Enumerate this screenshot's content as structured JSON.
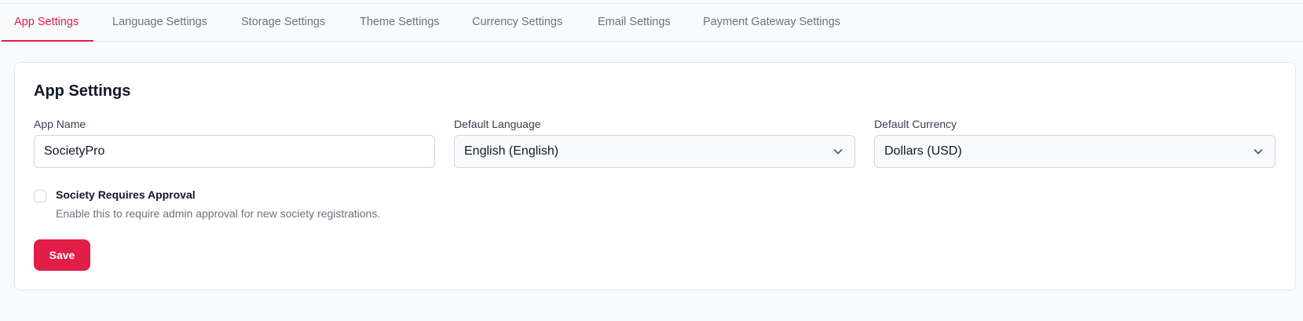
{
  "tabs": [
    {
      "label": "App Settings",
      "active": true
    },
    {
      "label": "Language Settings",
      "active": false
    },
    {
      "label": "Storage Settings",
      "active": false
    },
    {
      "label": "Theme Settings",
      "active": false
    },
    {
      "label": "Currency Settings",
      "active": false
    },
    {
      "label": "Email Settings",
      "active": false
    },
    {
      "label": "Payment Gateway Settings",
      "active": false
    }
  ],
  "card": {
    "title": "App Settings",
    "fields": {
      "app_name": {
        "label": "App Name",
        "value": "SocietyPro"
      },
      "default_language": {
        "label": "Default Language",
        "value": "English (English)"
      },
      "default_currency": {
        "label": "Default Currency",
        "value": "Dollars (USD)"
      }
    },
    "approval": {
      "label": "Society Requires Approval",
      "help": "Enable this to require admin approval for new society registrations.",
      "checked": false
    },
    "save_label": "Save"
  },
  "colors": {
    "accent": "#e11d48",
    "background": "#f9fafb",
    "border": "#e5e7eb"
  },
  "icons": {
    "select": "chevron-down-icon"
  }
}
